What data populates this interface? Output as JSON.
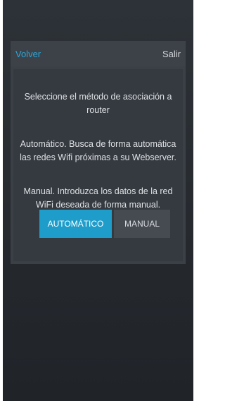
{
  "header": {
    "back_label": "Volver",
    "exit_label": "Salir"
  },
  "content": {
    "intro": "Seleccione el método de asociación a router",
    "auto_description": "Automático. Busca de forma automática las redes Wifi próximas a su Webserver.",
    "manual_description": "Manual. Introduzca los datos de la red WiFi deseada de forma manual."
  },
  "buttons": {
    "automatic_label": "AUTOMÁTICO",
    "manual_label": "MANUAL"
  },
  "colors": {
    "accent": "#1e9cca",
    "link": "#2ea6d6",
    "background": "#2a2e33"
  }
}
